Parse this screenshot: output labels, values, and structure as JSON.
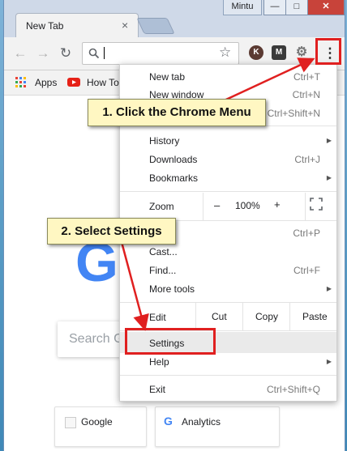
{
  "window": {
    "tab_title": "New Tab",
    "tab_close": "×",
    "user_name": "Mintu",
    "minimize": "—",
    "maximize": "□",
    "close": "✕"
  },
  "toolbar": {
    "back_icon": "←",
    "forward_icon": "→",
    "reload_icon": "↻",
    "search_icon": "🔍",
    "address_value": "",
    "star_icon": "☆",
    "menu_icon": "⋮",
    "ext_k": "K",
    "ext_m": "M",
    "ext_gear": "⚙"
  },
  "bookmarks": {
    "apps_label": "Apps",
    "howto_label": "How To"
  },
  "content": {
    "search_placeholder": "Search G",
    "tiles": [
      {
        "label": "Google"
      },
      {
        "label": "Analytics"
      }
    ]
  },
  "menu": {
    "new_tab": {
      "label": "New tab",
      "shortcut": "Ctrl+T"
    },
    "new_window": {
      "label": "New window",
      "shortcut": "Ctrl+N"
    },
    "new_incognito": {
      "shortcut": "Ctrl+Shift+N"
    },
    "history": {
      "label": "History"
    },
    "downloads": {
      "label": "Downloads",
      "shortcut": "Ctrl+J"
    },
    "bookmarks": {
      "label": "Bookmarks"
    },
    "zoom": {
      "label": "Zoom",
      "minus": "–",
      "value": "100%",
      "plus": "+",
      "fullscreen": "⛶"
    },
    "print": {
      "shortcut": "Ctrl+P"
    },
    "cast": {
      "label": "Cast..."
    },
    "find": {
      "label": "Find...",
      "shortcut": "Ctrl+F"
    },
    "more_tools": {
      "label": "More tools"
    },
    "edit": {
      "label": "Edit",
      "cut": "Cut",
      "copy": "Copy",
      "paste": "Paste"
    },
    "settings": {
      "label": "Settings"
    },
    "help": {
      "label": "Help"
    },
    "exit": {
      "label": "Exit",
      "shortcut": "Ctrl+Shift+Q"
    }
  },
  "annotations": {
    "step1": "1. Click the Chrome Menu",
    "step2": "2. Select Settings",
    "color_red": "#e02020",
    "color_callout": "#fff7c2"
  }
}
